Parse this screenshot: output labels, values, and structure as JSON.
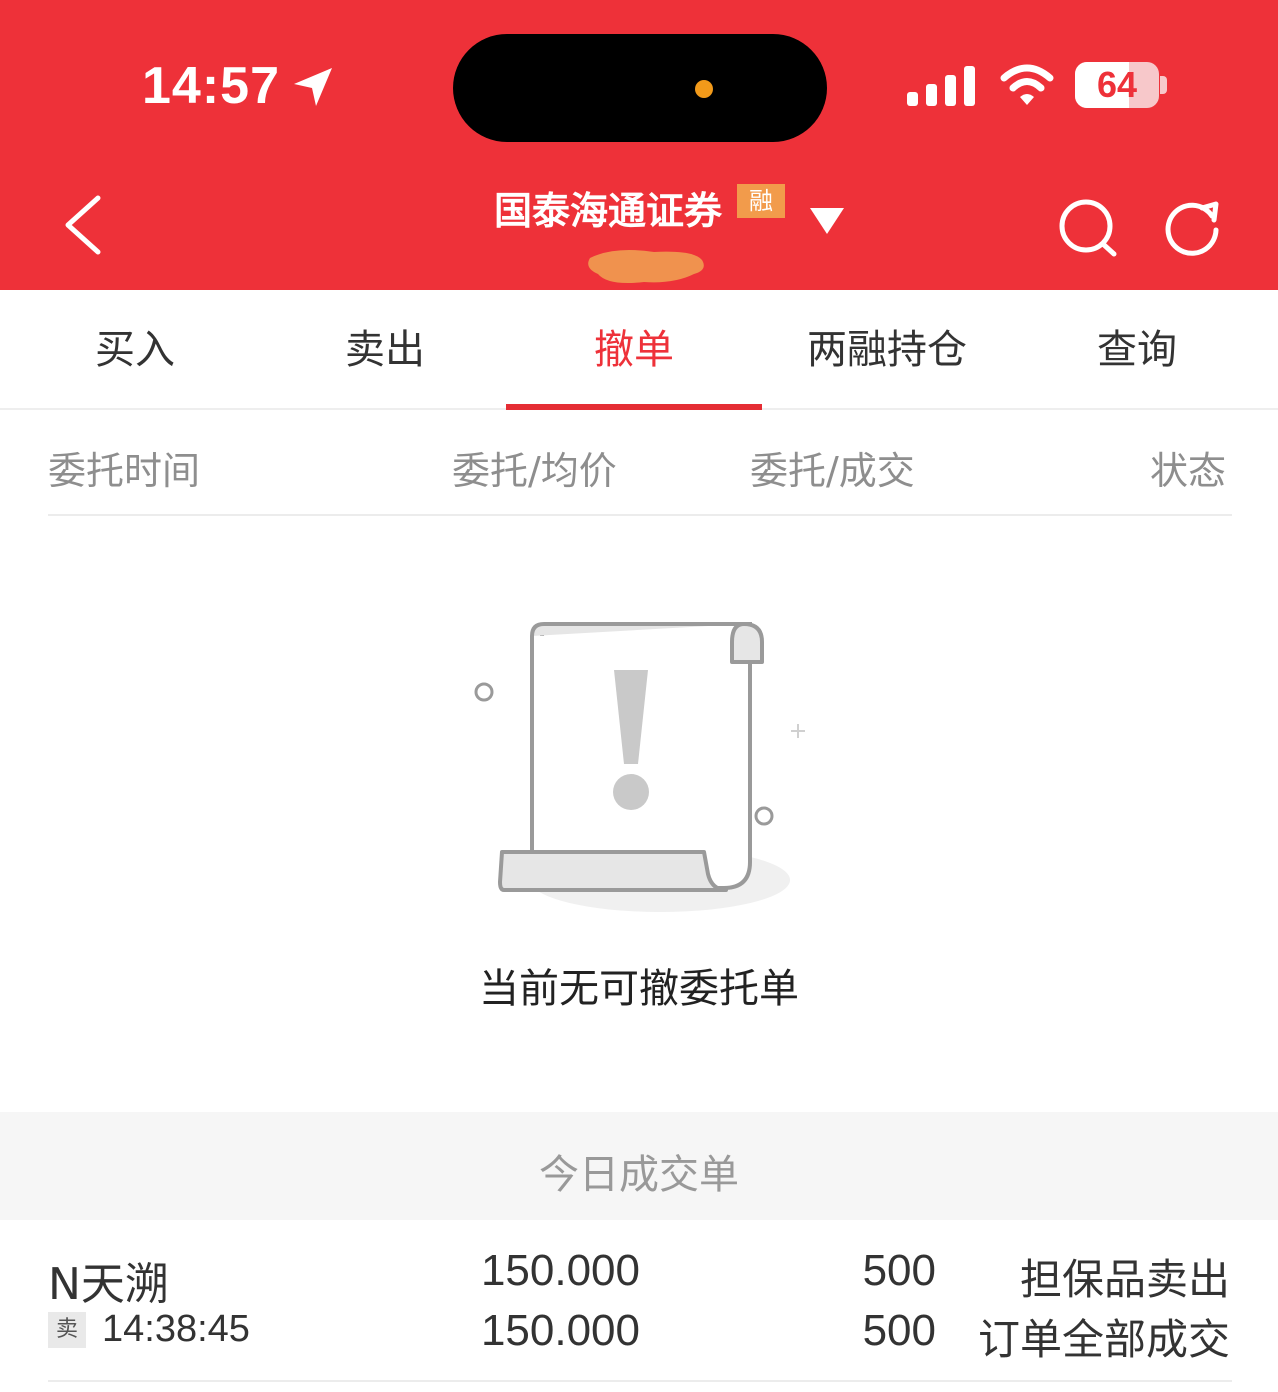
{
  "status_bar": {
    "time": "14:57",
    "battery_level": "64",
    "battery_fraction": 0.64,
    "icons": [
      "location-arrow-icon",
      "signal-icon",
      "wifi-icon",
      "battery-icon"
    ]
  },
  "header": {
    "broker_name": "国泰海通证券",
    "margin_badge": "融",
    "icons": [
      "back-icon",
      "dropdown-icon",
      "search-icon",
      "refresh-icon"
    ]
  },
  "tabs": [
    {
      "label": "买入",
      "active": false
    },
    {
      "label": "卖出",
      "active": false
    },
    {
      "label": "撤单",
      "active": true
    },
    {
      "label": "两融持仓",
      "active": false
    },
    {
      "label": "查询",
      "active": false
    }
  ],
  "orders_table": {
    "columns": [
      "委托时间",
      "委托/均价",
      "委托/成交",
      "状态"
    ],
    "empty_message": "当前无可撤委托单"
  },
  "today_trades": {
    "title": "今日成交单",
    "rows": [
      {
        "stock_name": "N天溯",
        "side": "卖",
        "time": "14:38:45",
        "order_price": "150.000",
        "avg_price": "150.000",
        "order_qty": "500",
        "filled_qty": "500",
        "order_type": "担保品卖出",
        "status": "订单全部成交"
      }
    ]
  },
  "colors": {
    "brand_red": "#ee3139",
    "badge_orange": "#f29b4b",
    "muted_text": "#8e8e8e"
  }
}
